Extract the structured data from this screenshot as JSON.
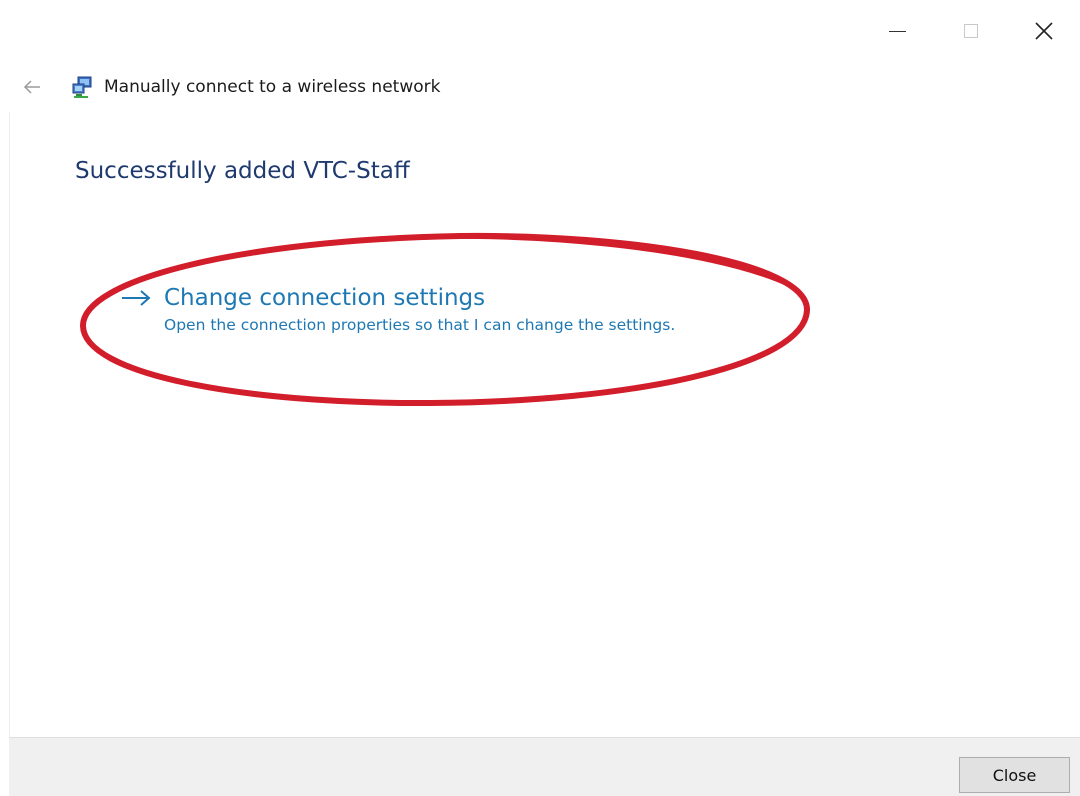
{
  "window": {
    "title": "Manually connect to a wireless network",
    "controls": {
      "minimize": "minimize-icon",
      "maximize": "maximize-icon",
      "close": "close-icon"
    }
  },
  "main": {
    "heading": "Successfully added VTC-Staff",
    "command_link": {
      "title": "Change connection settings",
      "description": "Open the connection properties so that I can change the settings.",
      "icon": "arrow-right-icon"
    }
  },
  "footer": {
    "close_label": "Close"
  },
  "colors": {
    "heading": "#1e3a6e",
    "link": "#1e78b3",
    "annotation": "#d21e2b",
    "footer_bg": "#f0f0f0"
  }
}
